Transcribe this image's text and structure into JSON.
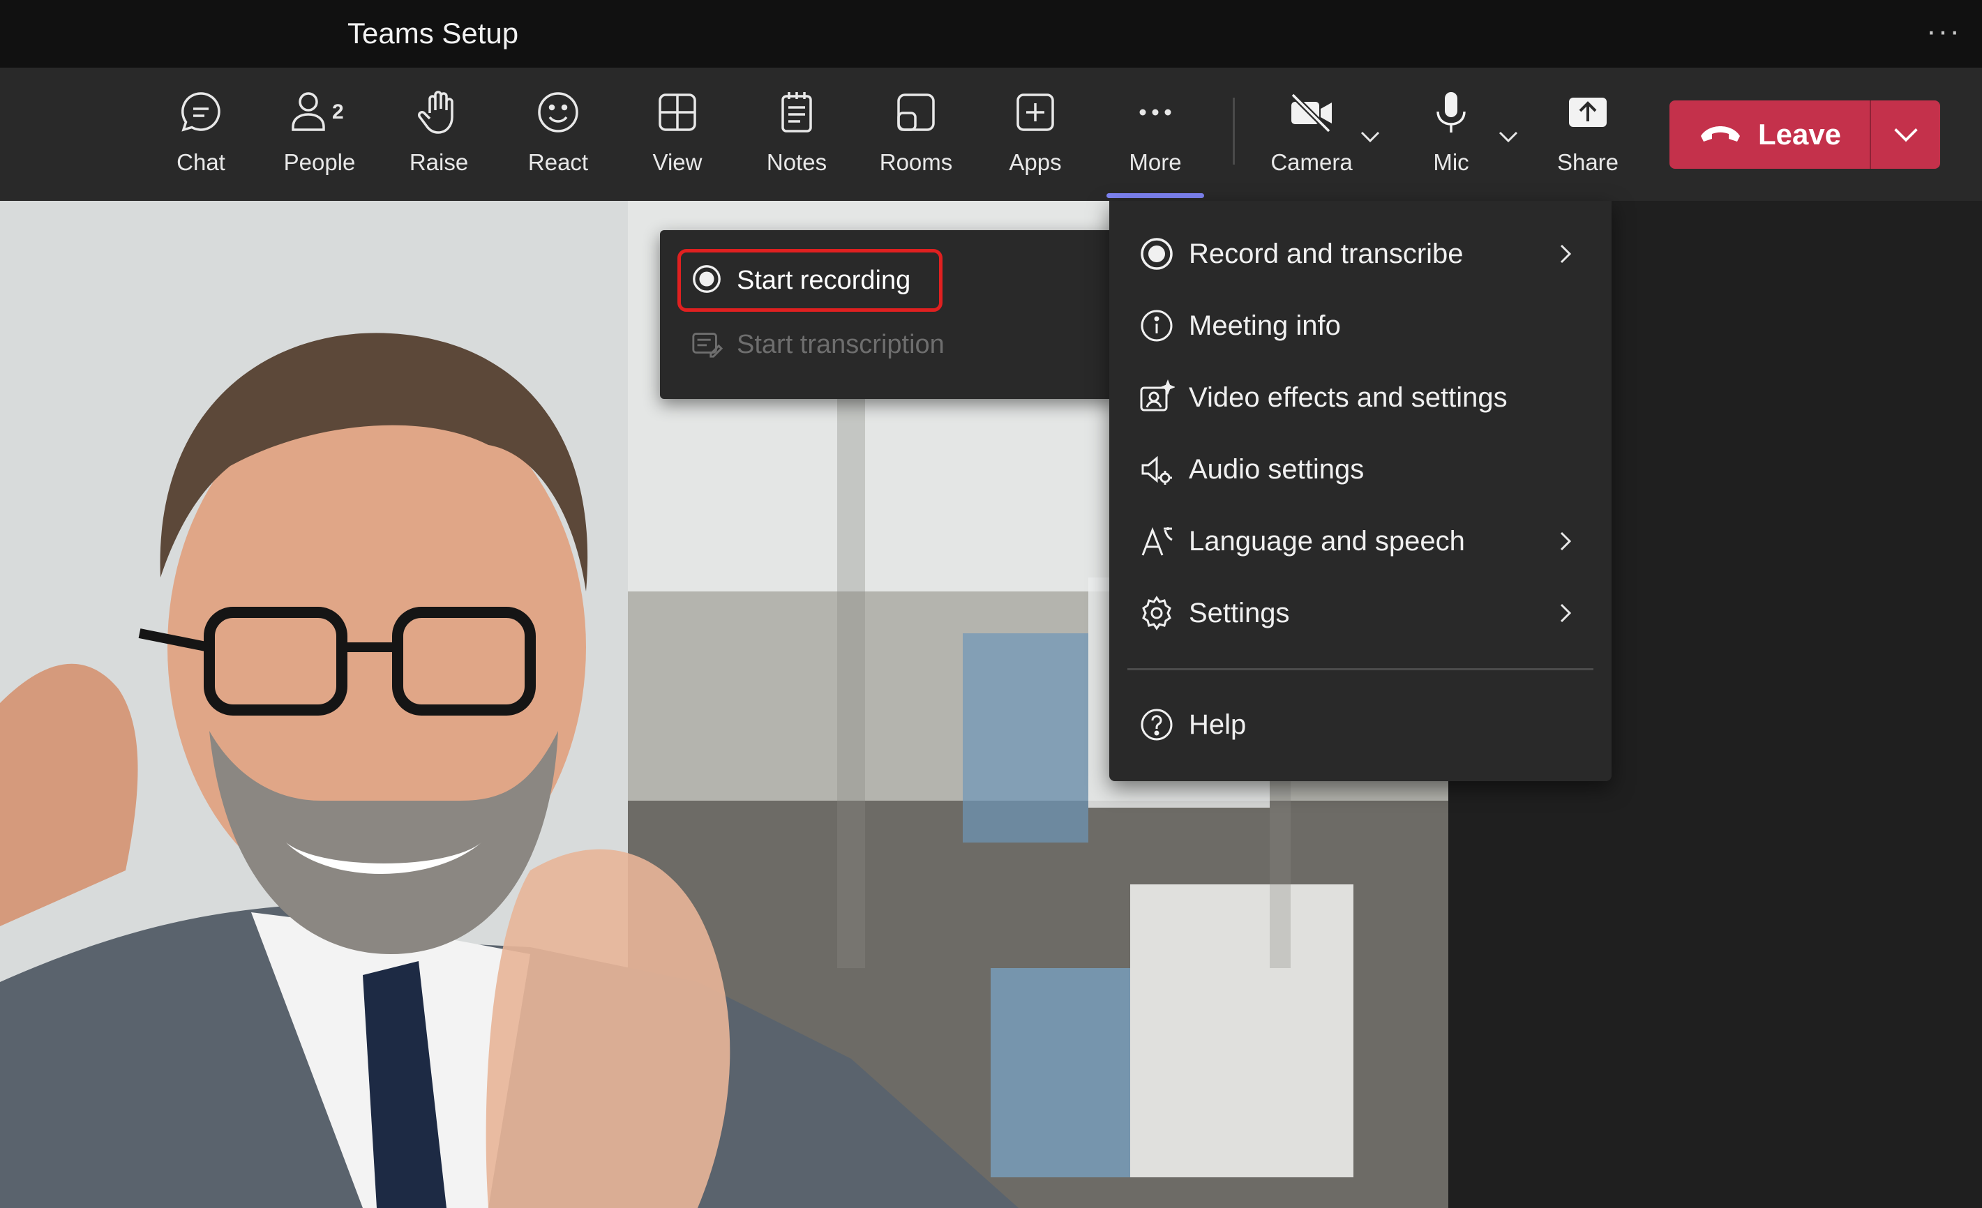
{
  "window": {
    "title": "Teams Setup",
    "more_label": "···"
  },
  "toolbar": {
    "items": [
      {
        "label": "Chat"
      },
      {
        "label": "People",
        "badge": "2"
      },
      {
        "label": "Raise"
      },
      {
        "label": "React"
      },
      {
        "label": "View"
      },
      {
        "label": "Notes"
      },
      {
        "label": "Rooms"
      },
      {
        "label": "Apps"
      },
      {
        "label": "More",
        "active": true
      },
      {
        "label": "Camera"
      },
      {
        "label": "Mic"
      },
      {
        "label": "Share"
      }
    ],
    "leave_label": "Leave"
  },
  "more_menu": {
    "items": [
      {
        "label": "Record and transcribe",
        "icon": "record-icon",
        "has_submenu": true
      },
      {
        "label": "Meeting info",
        "icon": "info-icon"
      },
      {
        "label": "Video effects and settings",
        "icon": "video-effects-icon"
      },
      {
        "label": "Audio settings",
        "icon": "audio-settings-icon"
      },
      {
        "label": "Language and speech",
        "icon": "language-icon",
        "has_submenu": true
      },
      {
        "label": "Settings",
        "icon": "gear-icon",
        "has_submenu": true
      },
      {
        "label": "Help",
        "icon": "help-icon"
      }
    ]
  },
  "record_submenu": {
    "items": [
      {
        "label": "Start recording",
        "highlighted": true
      },
      {
        "label": "Start transcription",
        "disabled": true
      }
    ]
  },
  "colors": {
    "accent": "#7f85f5",
    "leave": "#c4314b",
    "highlight": "#e02020"
  }
}
